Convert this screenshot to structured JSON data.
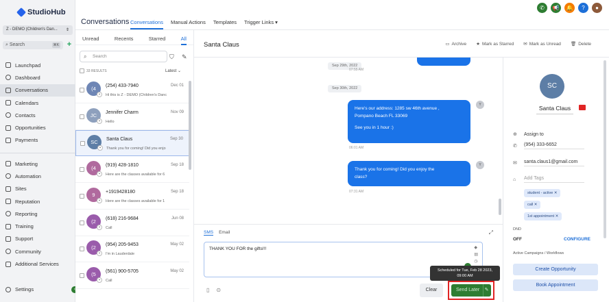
{
  "app": {
    "logo_text": "StudioHub",
    "account": "Z - DEMO (Children's Dan...",
    "search_placeholder": "Search",
    "search_shortcut": "⌘K",
    "add_label": "+"
  },
  "sidebar": {
    "items": [
      {
        "label": "Launchpad",
        "icon": "rocket-icon"
      },
      {
        "label": "Dashboard",
        "icon": "dashboard-icon"
      },
      {
        "label": "Conversations",
        "icon": "chat-icon"
      },
      {
        "label": "Calendars",
        "icon": "calendar-icon"
      },
      {
        "label": "Contacts",
        "icon": "contacts-icon"
      },
      {
        "label": "Opportunities",
        "icon": "opportunities-icon"
      },
      {
        "label": "Payments",
        "icon": "payments-icon"
      }
    ],
    "items2": [
      {
        "label": "Marketing",
        "icon": "marketing-icon"
      },
      {
        "label": "Automation",
        "icon": "automation-icon"
      },
      {
        "label": "Sites",
        "icon": "sites-icon"
      },
      {
        "label": "Reputation",
        "icon": "reputation-icon"
      },
      {
        "label": "Reporting",
        "icon": "reporting-icon"
      },
      {
        "label": "Training",
        "icon": "training-icon"
      },
      {
        "label": "Support",
        "icon": "support-icon"
      },
      {
        "label": "Community",
        "icon": "community-icon"
      },
      {
        "label": "Additional Services",
        "icon": "services-icon"
      }
    ],
    "settings_label": "Settings"
  },
  "header": {
    "title": "Conversations",
    "tabs": [
      "Conversations",
      "Manual Actions",
      "Templates",
      "Trigger Links ▾"
    ],
    "icons": [
      {
        "name": "phone-icon",
        "glyph": "✆",
        "color": "#2e7d32"
      },
      {
        "name": "megaphone-icon",
        "glyph": "📢",
        "color": "#2e7d32"
      },
      {
        "name": "bell-icon",
        "glyph": "🔔",
        "color": "#f57c00"
      },
      {
        "name": "help-icon",
        "glyph": "?",
        "color": "#1d6fd8"
      },
      {
        "name": "user-photo-icon",
        "glyph": "●",
        "color": "#8d5a3a"
      }
    ]
  },
  "list": {
    "tabs": [
      "Unread",
      "Recents",
      "Starred",
      "All"
    ],
    "search_placeholder": "Search",
    "results_label": "33 RESULTS",
    "sort_label": "Latest",
    "conversations": [
      {
        "initials": "(4",
        "color": "#6e86b5",
        "name": "(254) 433-7940",
        "date": "Dec 01",
        "snippet": "Hi this is Z - DEMO (Children's Danc"
      },
      {
        "initials": "JC",
        "color": "#8ea0bd",
        "name": "Jennifer Charm",
        "date": "Nov 09",
        "snippet": "Hello"
      },
      {
        "initials": "SC",
        "color": "#5d7ea6",
        "name": "Santa Claus",
        "date": "Sep 30",
        "snippet": "Thank you for coming! Did you enjo"
      },
      {
        "initials": "(4",
        "color": "#b06a9e",
        "name": "(919) 428-1810",
        "date": "Sep 18",
        "snippet": "Here are the classes available for 6"
      },
      {
        "initials": "9",
        "color": "#b06a9e",
        "name": "+1919428180",
        "date": "Sep 18",
        "snippet": "Here are the classes available for 1"
      },
      {
        "initials": "(2",
        "color": "#9a5cab",
        "name": "(618) 216-9684",
        "date": "Jun 08",
        "snippet": "Call"
      },
      {
        "initials": "(2",
        "color": "#9a5cab",
        "name": "(954) 205-9453",
        "date": "May 02",
        "snippet": "I'm in Lauderdale"
      },
      {
        "initials": "(5",
        "color": "#9a5cab",
        "name": "(561) 900-5705",
        "date": "May 02",
        "snippet": "Call"
      }
    ]
  },
  "chat": {
    "contact_name": "Santa Claus",
    "actions": [
      "Archive",
      "Mark as Starred",
      "Mark as Unread",
      "Delete"
    ],
    "date1": "Sep 29th, 2022",
    "time0": "07:55 AM",
    "date2": "Sep 30th, 2022",
    "msg1_line1": "Here's our address: 1285 sw 46th avenue ,",
    "msg1_line2": "Pompano Beach FL 33069",
    "msg1_line3": "See you in 1 hour :)",
    "time1": "06:01 AM",
    "msg2_line1": "Thank you for coming! Did you enjoy the",
    "msg2_line2": "class?",
    "time2": "07:31 AM",
    "sender_initial": "Y"
  },
  "composer": {
    "tabs": [
      "SMS",
      "Email"
    ],
    "text": "THANK YOU FOR the gifts!!!",
    "clear_label": "Clear",
    "send_label": "Send Later",
    "tooltip_line1": "Scheduled for Tue, Feb 28 2023,",
    "tooltip_line2": "09:00 AM"
  },
  "contact": {
    "initials": "SC",
    "name": "Santa Claus",
    "assign_label": "Assign to",
    "phone": "(954) 333-6652",
    "email": "santa.claus1@gmail.com",
    "tags_placeholder": "Add Tags",
    "tags": [
      "student - active",
      "call",
      "1st appointment"
    ],
    "dnd_label": "DND",
    "dnd_value": "OFF",
    "configure_label": "CONFIGURE",
    "campaigns_label": "Active Campaigns / Workflows",
    "create_opp_label": "Create Opportunity",
    "book_label": "Book Appointment"
  }
}
